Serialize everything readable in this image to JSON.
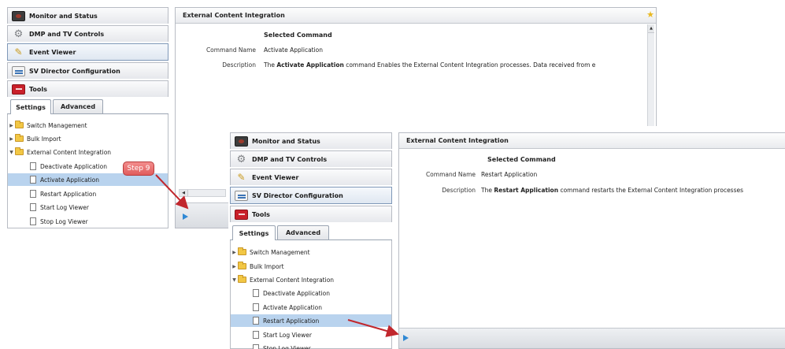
{
  "nav_buttons": [
    {
      "label": "Monitor and Status",
      "icon": "monitor-status-icon"
    },
    {
      "label": "DMP and TV Controls",
      "icon": "gear-icon"
    },
    {
      "label": "Event Viewer",
      "icon": "pencil-icon"
    },
    {
      "label": "SV Director Configuration",
      "icon": "sv-director-icon"
    },
    {
      "label": "Tools",
      "icon": "toolbox-icon"
    }
  ],
  "tabs": {
    "settings": "Settings",
    "advanced": "Advanced"
  },
  "tree": {
    "switch_management": "Switch Management",
    "bulk_import": "Bulk Import",
    "external_content_integration": "External Content Integration",
    "deactivate_application": "Deactivate Application",
    "activate_application": "Activate Application",
    "restart_application": "Restart Application",
    "start_log_viewer": "Start Log Viewer",
    "stop_log_viewer": "Stop Log Viewer"
  },
  "panel_title": "External Content Integration",
  "section_title": "Selected Command",
  "command_name_label": "Command Name",
  "description_label": "Description",
  "screen1": {
    "command_name": "Activate Application",
    "desc_pre": "The ",
    "desc_bold": "Activate Application",
    "desc_post": " command Enables the External Content Integration processes.  Data received from e"
  },
  "screen2": {
    "command_name": "Restart Application",
    "desc_pre": "The ",
    "desc_bold": "Restart Application",
    "desc_post": " command restarts the External Content Integration processes"
  },
  "callout": "Step 9",
  "colors": {
    "arrow": "#c1272d",
    "selection": "#b9d3ee",
    "play": "#2f88d4"
  }
}
